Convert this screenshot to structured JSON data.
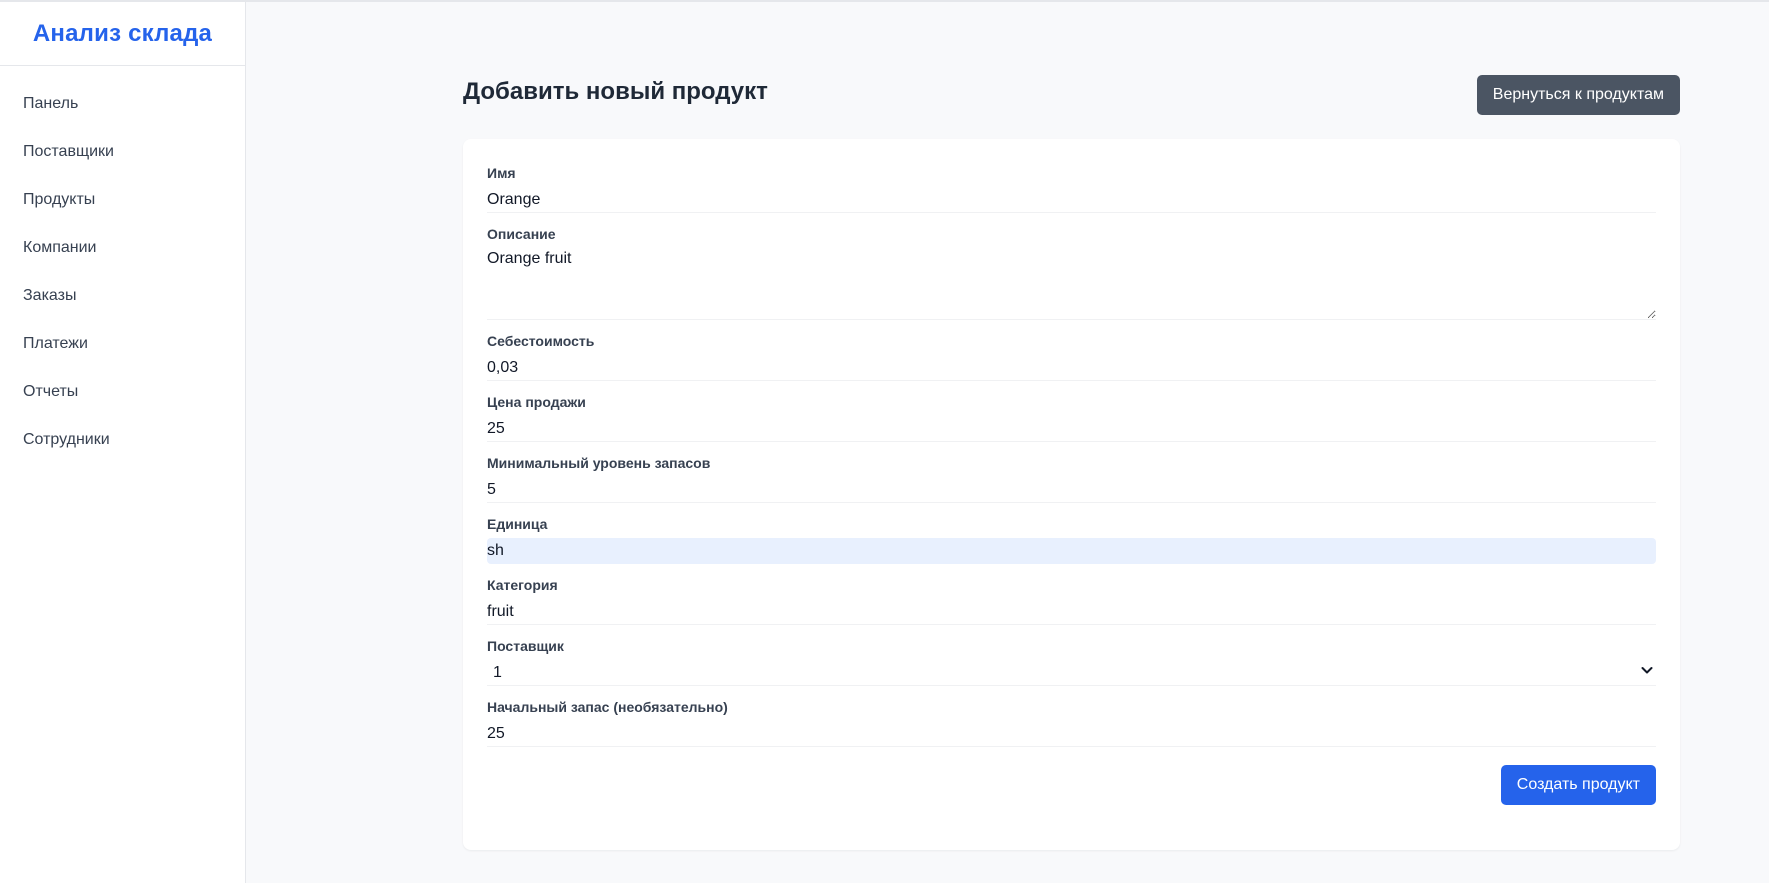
{
  "app": {
    "brand": "Анализ склада"
  },
  "sidebar": {
    "items": [
      {
        "label": "Панель"
      },
      {
        "label": "Поставщики"
      },
      {
        "label": "Продукты"
      },
      {
        "label": "Компании"
      },
      {
        "label": "Заказы"
      },
      {
        "label": "Платежи"
      },
      {
        "label": "Отчеты"
      },
      {
        "label": "Сотрудники"
      }
    ]
  },
  "page": {
    "title": "Добавить новый продукт",
    "back_button": "Вернуться к продуктам"
  },
  "form": {
    "name": {
      "label": "Имя",
      "value": "Orange"
    },
    "description": {
      "label": "Описание",
      "value": "Orange fruit"
    },
    "cost": {
      "label": "Себестоимость",
      "value": "0,03"
    },
    "price": {
      "label": "Цена продажи",
      "value": "25"
    },
    "min_stock": {
      "label": "Минимальный уровень запасов",
      "value": "5"
    },
    "unit": {
      "label": "Единица",
      "value": "sh"
    },
    "category": {
      "label": "Категория",
      "value": "fruit"
    },
    "supplier": {
      "label": "Поставщик",
      "value": "1",
      "options": [
        "1"
      ]
    },
    "initial_stock": {
      "label": "Начальный запас (необязательно)",
      "value": "25"
    },
    "submit": "Создать продукт"
  },
  "colors": {
    "accent": "#2563eb",
    "back_button_bg": "#4b5563",
    "autofill_bg": "#e8f0fe",
    "page_bg": "#f8f9fb"
  }
}
